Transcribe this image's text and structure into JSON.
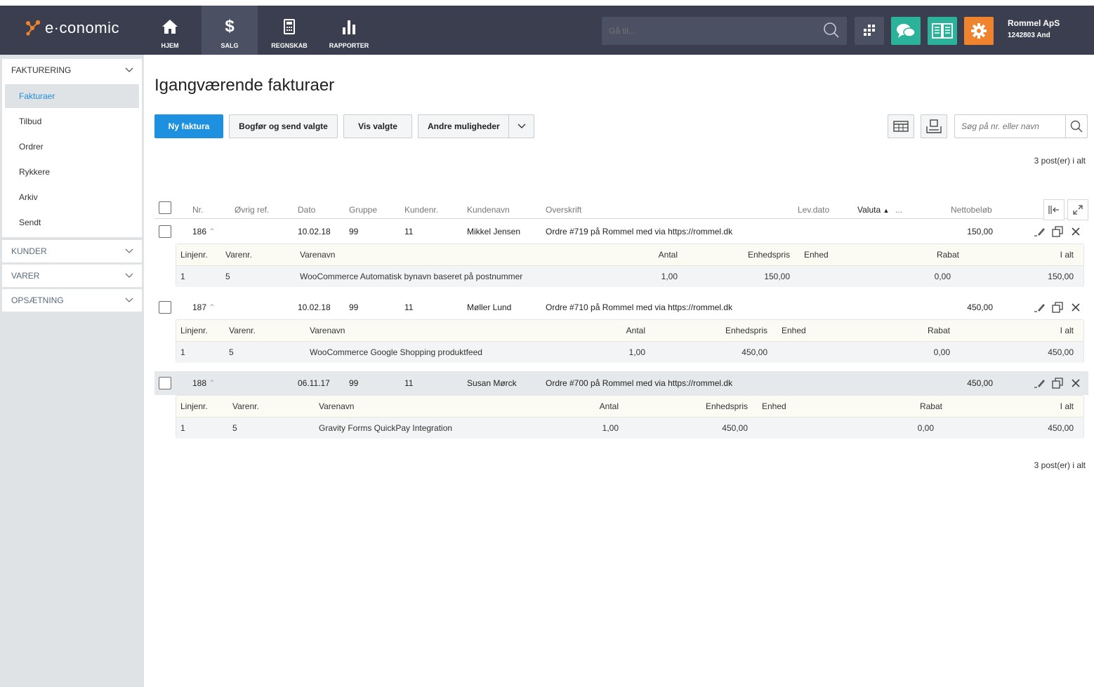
{
  "brand": {
    "name": "e·conomic"
  },
  "nav": [
    {
      "label": "HJEM",
      "icon": "home-icon"
    },
    {
      "label": "SALG",
      "icon": "dollar-icon"
    },
    {
      "label": "REGNSKAB",
      "icon": "calculator-icon"
    },
    {
      "label": "RAPPORTER",
      "icon": "bar-chart-icon"
    }
  ],
  "goto": {
    "placeholder": "Gå til..."
  },
  "company": {
    "name": "Rommel ApS",
    "id": "1242803 And"
  },
  "colors": {
    "topbar": "#3a3e4f",
    "primary": "#1e90e0",
    "chat": "#2bb29a",
    "book": "#2bb29a",
    "settings": "#f0832e"
  },
  "sidebar": {
    "fakturering": "FAKTURERING",
    "items": [
      {
        "label": "Fakturaer",
        "active": true
      },
      {
        "label": "Tilbud"
      },
      {
        "label": "Ordrer"
      },
      {
        "label": "Rykkere"
      },
      {
        "label": "Arkiv"
      },
      {
        "label": "Sendt"
      }
    ],
    "kunder": "KUNDER",
    "varer": "VARER",
    "opsaetning": "OPSÆTNING"
  },
  "page": {
    "title": "Igangværende fakturaer",
    "count_top": "3 post(er) i alt",
    "count_bottom": "3 post(er) i alt"
  },
  "toolbar": {
    "new": "Ny faktura",
    "post_send": "Bogfør og send valgte",
    "show": "Vis valgte",
    "more": "Andre muligheder"
  },
  "search": {
    "placeholder": "Søg på nr. eller navn"
  },
  "columns": {
    "nr": "Nr.",
    "ref": "Øvrig ref.",
    "dato": "Dato",
    "gruppe": "Gruppe",
    "kundenr": "Kundenr.",
    "kundenavn": "Kundenavn",
    "overskrift": "Overskrift",
    "levdato": "Lev.dato",
    "valuta": "Valuta",
    "more": "...",
    "netto": "Nettobeløb"
  },
  "line_columns": {
    "linjenr": "Linjenr.",
    "varenr": "Varenr.",
    "varenavn": "Varenavn",
    "antal": "Antal",
    "enhedspris": "Enhedspris",
    "enhed": "Enhed",
    "rabat": "Rabat",
    "ialt": "I alt"
  },
  "invoices": [
    {
      "nr": "186",
      "dato": "10.02.18",
      "gruppe": "99",
      "kundenr": "11",
      "kundenavn": "Mikkel Jensen",
      "overskrift": "Ordre #719 på Rommel med via https://rommel.dk",
      "netto": "150,00",
      "line": {
        "linjenr": "1",
        "varenr": "5",
        "varenavn": "WooCommerce Automatisk bynavn baseret på postnummer",
        "antal": "1,00",
        "enhedspris": "150,00",
        "rabat": "0,00",
        "ialt": "150,00"
      }
    },
    {
      "nr": "187",
      "dato": "10.02.18",
      "gruppe": "99",
      "kundenr": "11",
      "kundenavn": "Møller Lund",
      "overskrift": "Ordre #710 på Rommel med via https://rommel.dk",
      "netto": "450,00",
      "line": {
        "linjenr": "1",
        "varenr": "5",
        "varenavn": "WooCommerce Google Shopping produktfeed",
        "antal": "1,00",
        "enhedspris": "450,00",
        "rabat": "0,00",
        "ialt": "450,00"
      }
    },
    {
      "nr": "188",
      "dato": "06.11.17",
      "gruppe": "99",
      "kundenr": "11",
      "kundenavn": "Susan Mørck",
      "overskrift": "Ordre #700 på Rommel med via https://rommel.dk",
      "netto": "450,00",
      "line": {
        "linjenr": "1",
        "varenr": "5",
        "varenavn": "Gravity Forms QuickPay Integration",
        "antal": "1,00",
        "enhedspris": "450,00",
        "rabat": "0,00",
        "ialt": "450,00"
      }
    }
  ]
}
